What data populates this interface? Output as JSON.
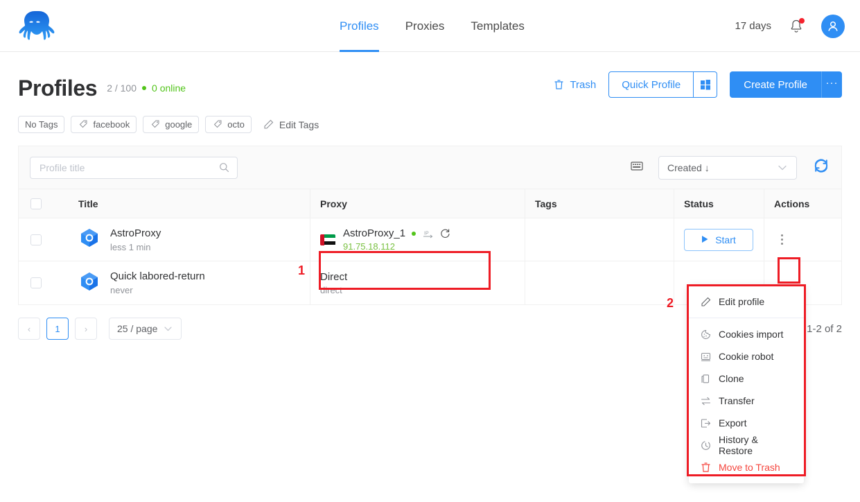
{
  "header": {
    "logo_alt": "octo-browser-logo",
    "nav": [
      {
        "label": "Profiles",
        "active": true
      },
      {
        "label": "Proxies",
        "active": false
      },
      {
        "label": "Templates",
        "active": false
      }
    ],
    "days_left": "17 days",
    "notification_badge": true
  },
  "page": {
    "title": "Profiles",
    "count": "2 / 100",
    "online": "0 online"
  },
  "actions": {
    "trash": "Trash",
    "quick_profile": "Quick Profile",
    "quick_profile_os_icon": "windows-icon",
    "create_profile": "Create Profile",
    "create_more": "···"
  },
  "tags": {
    "items": [
      {
        "label": "No Tags",
        "has_icon": false
      },
      {
        "label": "facebook",
        "has_icon": true
      },
      {
        "label": "google",
        "has_icon": true
      },
      {
        "label": "octo",
        "has_icon": true
      }
    ],
    "edit": "Edit Tags"
  },
  "filters": {
    "search_placeholder": "Profile title",
    "search_value": "",
    "sort_value": "Created ↓",
    "columns_icon": "columns-icon",
    "refresh_icon": "refresh-icon"
  },
  "table": {
    "columns": [
      "Title",
      "Proxy",
      "Tags",
      "Status",
      "Actions"
    ],
    "rows": [
      {
        "title": "AstroProxy",
        "subtitle": "less 1 min",
        "proxy_name": "AstroProxy_1",
        "proxy_status_dot": "#52c41a",
        "proxy_ip": "91.75.18.112",
        "proxy_flag": "united-arab-emirates",
        "tags": "",
        "status_button": "Start"
      },
      {
        "title": "Quick labored-return",
        "subtitle": "never",
        "proxy_name": "Direct",
        "proxy_ip": "",
        "proxy_sub": "direct",
        "tags": "",
        "status_button": ""
      }
    ]
  },
  "pagination": {
    "prev": "‹",
    "page": "1",
    "next": "›",
    "page_size": "25 / page",
    "total": "1-2 of 2"
  },
  "context_menu": {
    "items": [
      {
        "label": "Edit profile",
        "icon": "pencil-icon",
        "danger": false
      },
      {
        "label": "Cookies import",
        "icon": "cookie-icon",
        "danger": false
      },
      {
        "label": "Cookie robot",
        "icon": "robot-icon",
        "danger": false
      },
      {
        "label": "Clone",
        "icon": "copy-icon",
        "danger": false
      },
      {
        "label": "Transfer",
        "icon": "swap-icon",
        "danger": false
      },
      {
        "label": "Export",
        "icon": "export-icon",
        "danger": false
      },
      {
        "label": "History & Restore",
        "icon": "clock-icon",
        "danger": false
      },
      {
        "label": "Move to Trash",
        "icon": "trash-icon",
        "danger": true
      }
    ]
  },
  "annotations": [
    {
      "number": "1",
      "target": "proxy-cell"
    },
    {
      "number": "2",
      "target": "row-actions-menu"
    }
  ],
  "colors": {
    "accent": "#2f8ef4",
    "online_green": "#52c41a",
    "danger_red": "#f5453d",
    "annotation_red": "#ee1c25"
  }
}
